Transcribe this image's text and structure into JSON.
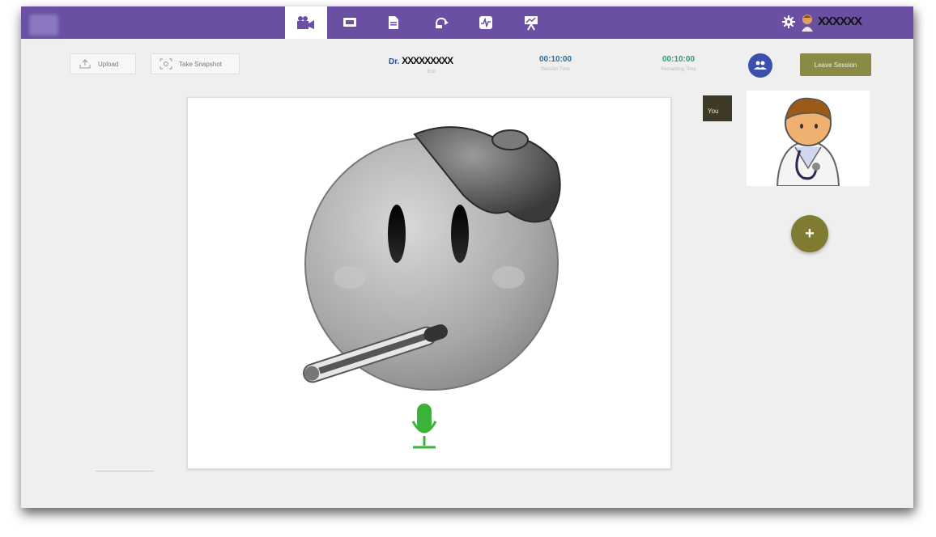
{
  "topbar": {
    "nav_icons": [
      "video-call-icon",
      "screen-icon",
      "document-icon",
      "refresh-cloud-icon",
      "vitals-icon",
      "presentation-icon"
    ],
    "active_index": 0,
    "username": "XXXXXX",
    "accent_color": "#6a4fa3"
  },
  "toolbar": {
    "upload_label": "Upload",
    "snapshot_label": "Take Snapshot"
  },
  "session": {
    "doctor_prefix": "Dr. ",
    "doctor_name_redacted": "XXXXXXXXX",
    "doctor_sub": "Exit",
    "session_time": "00:10:00",
    "session_time_label": "Session Time",
    "remaining_time": "00:10:00",
    "remaining_time_label": "Remaining Time",
    "leave_label": "Leave Session",
    "leave_color": "#8a8a45"
  },
  "self_view": {
    "you_label": "You"
  },
  "add_button": {
    "label": "+"
  }
}
